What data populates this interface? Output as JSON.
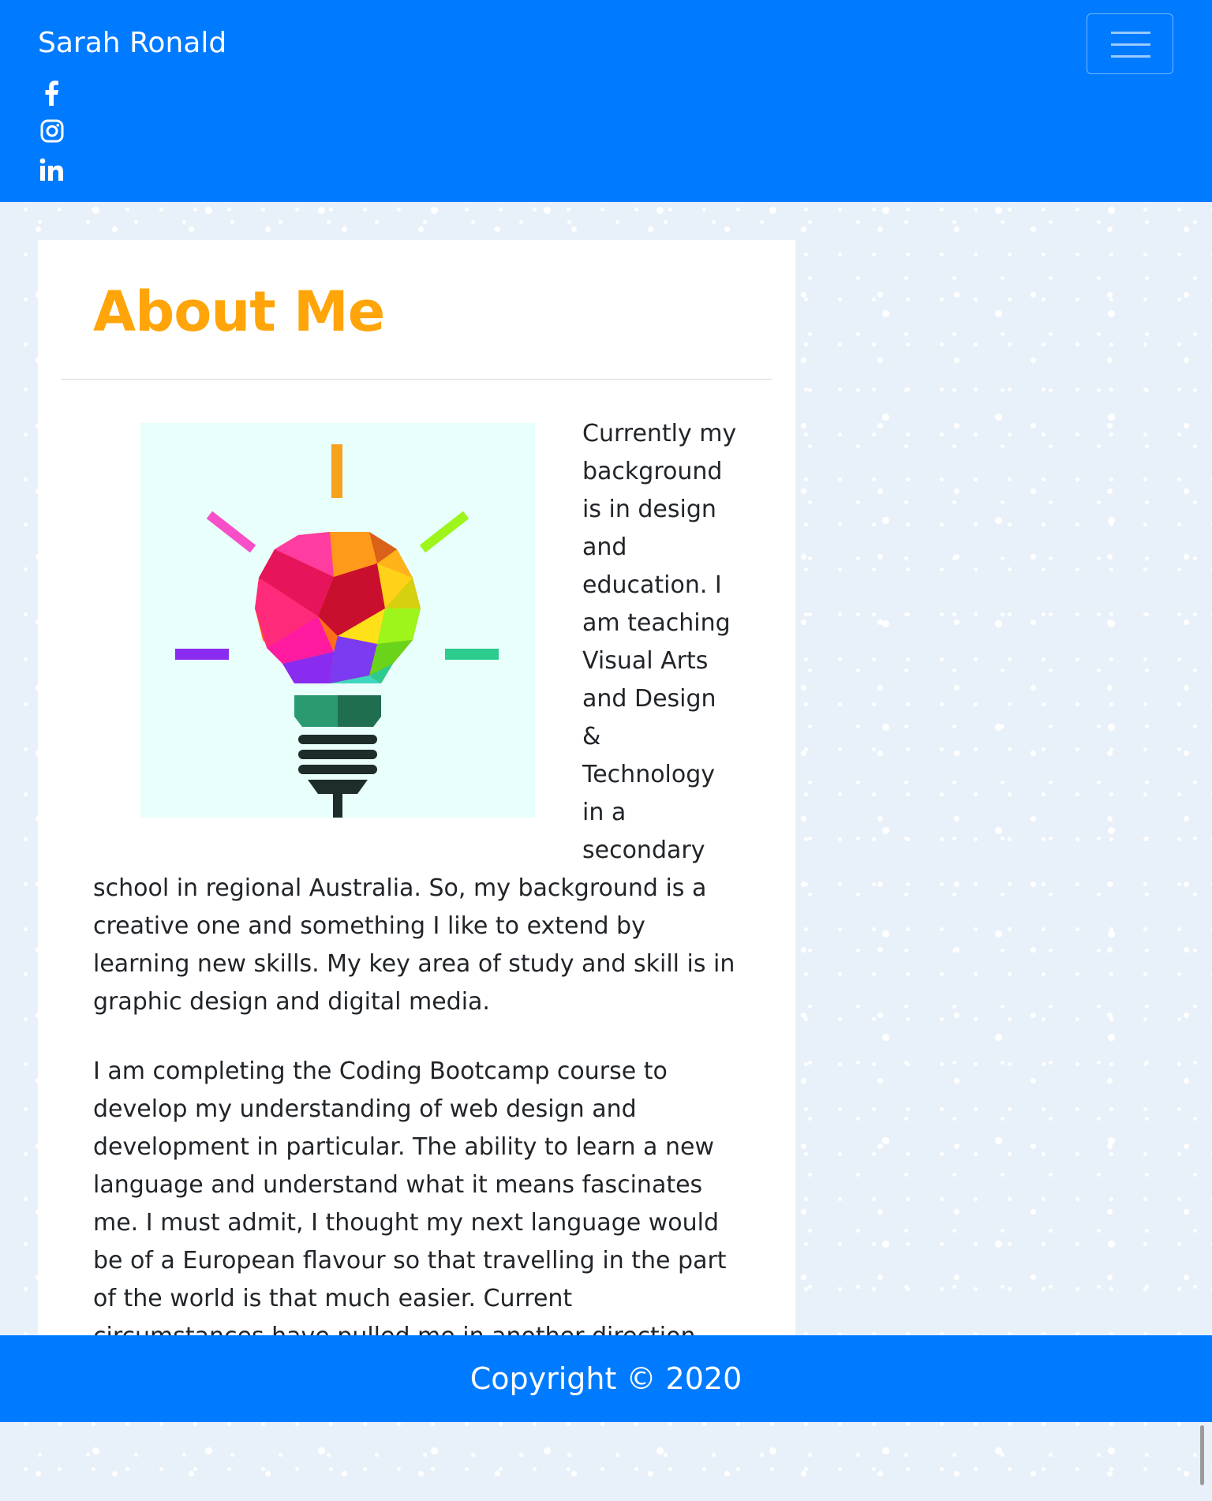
{
  "navbar": {
    "brand": "Sarah Ronald",
    "social": [
      {
        "icon": "facebook-icon"
      },
      {
        "icon": "instagram-icon"
      },
      {
        "icon": "linkedin-icon"
      }
    ],
    "toggle_icon": "hamburger-menu-icon",
    "color": "#007bff"
  },
  "about": {
    "title": "About Me",
    "title_color": "#ffa50a",
    "image_icon": "lightbulb-icon",
    "paragraphs": [
      "Currently my background is in design and education. I am teaching Visual Arts and Design & Technology in a secondary school in regional Australia. So, my background is a creative one and something I like to extend by learning new skills. My key area of study and skill is in graphic design and digital media.",
      "I am completing the Coding Bootcamp course to develop my understanding of web design and development in particular. The ability to learn a new language and understand what it means fascinates me. I must admit, I thought my next language would be of a European flavour so that travelling in the part of the world is that much easier. Current circumstances have pulled me in another direction and I look forward to seeign where it takes me. Thanks for taking an interest"
    ]
  },
  "footer": {
    "text": "Copyright © 2020"
  }
}
